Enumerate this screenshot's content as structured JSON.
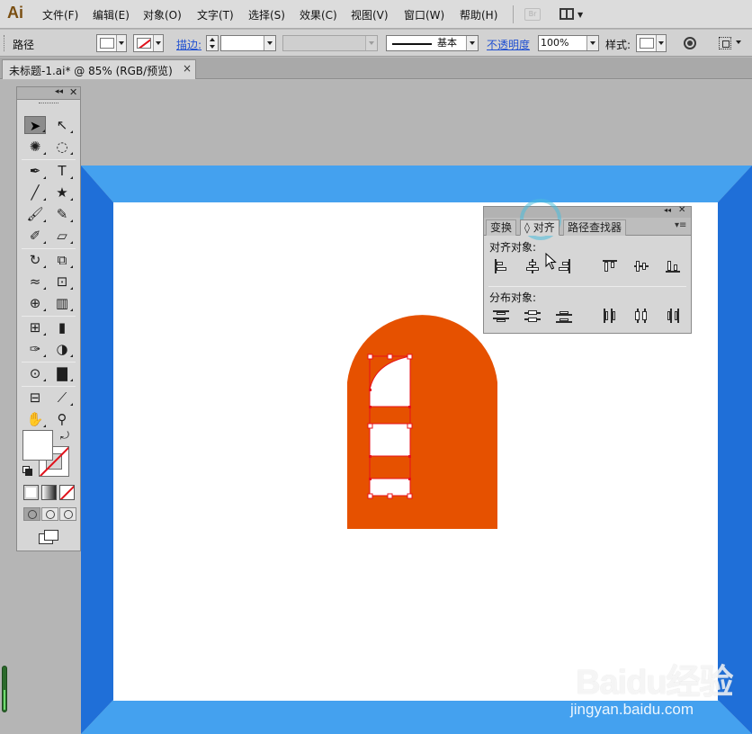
{
  "app": {
    "logo": "Ai"
  },
  "menu": {
    "items": [
      "文件(F)",
      "编辑(E)",
      "对象(O)",
      "文字(T)",
      "选择(S)",
      "效果(C)",
      "视图(V)",
      "窗口(W)",
      "帮助(H)"
    ],
    "bridge": "Br"
  },
  "control_bar": {
    "object_type": "路径",
    "stroke_link": "描边:",
    "stroke_profile": "基本",
    "opacity_link": "不透明度",
    "opacity_value": "100%",
    "style_label": "样式:"
  },
  "document": {
    "tab_title": "未标题-1.ai* @ 85% (RGB/预览)",
    "close": "×"
  },
  "align_panel": {
    "tabs": [
      "变换",
      "◊ 对齐",
      "路径查找器"
    ],
    "active_tab": "对齐",
    "align_objects_label": "对齐对象:",
    "distribute_objects_label": "分布对象:"
  },
  "colors": {
    "artwork_fill": "#e65100",
    "frame_outer": "#1f6fd8",
    "frame_inner": "#44a1ef",
    "artboard": "#ffffff",
    "selection": "#e8111a",
    "link": "#1f4fd1"
  },
  "icons": [
    "selection-tool-icon",
    "direct-selection-tool-icon",
    "magic-wand-icon",
    "lasso-icon",
    "pen-tool-icon",
    "type-tool-icon",
    "line-tool-icon",
    "star-tool-icon",
    "paintbrush-icon",
    "pencil-icon",
    "blob-brush-icon",
    "eraser-icon",
    "rotate-icon",
    "scale-icon",
    "width-tool-icon",
    "free-transform-icon",
    "shape-builder-icon",
    "perspective-grid-icon",
    "mesh-icon",
    "gradient-icon",
    "eyedropper-icon",
    "blend-icon",
    "symbol-sprayer-icon",
    "column-graph-icon",
    "artboard-tool-icon",
    "slice-tool-icon",
    "hand-tool-icon",
    "zoom-tool-icon"
  ],
  "watermark": {
    "logo": "Baidu经验",
    "url": "jingyan.baidu.com"
  }
}
